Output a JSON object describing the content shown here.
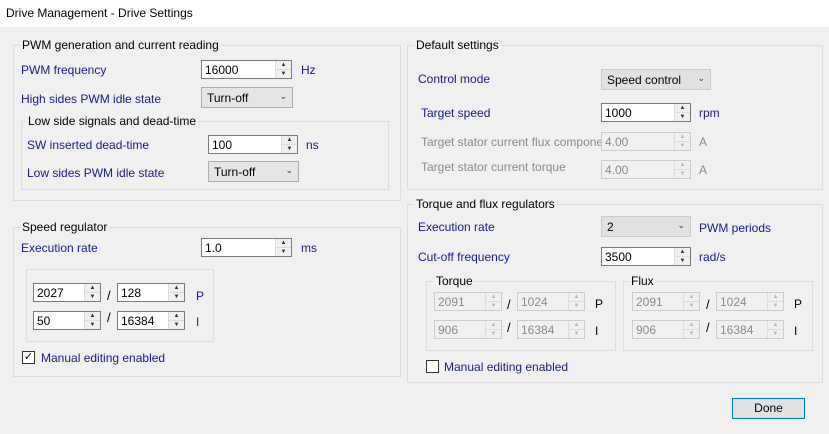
{
  "window": {
    "title": "Drive Management - Drive Settings"
  },
  "pwm": {
    "group_label": "PWM generation and current reading",
    "freq_label": "PWM frequency",
    "freq_value": "16000",
    "freq_unit": "Hz",
    "high_idle_label": "High sides PWM idle state",
    "high_idle_value": "Turn-off",
    "low_group_label": "Low side signals and dead-time",
    "dead_label": "SW inserted dead-time",
    "dead_value": "100",
    "dead_unit": "ns",
    "low_idle_label": "Low sides PWM idle state",
    "low_idle_value": "Turn-off"
  },
  "speed_reg": {
    "group_label": "Speed regulator",
    "rate_label": "Execution rate",
    "rate_value": "1.0",
    "rate_unit": "ms",
    "p_num": "2027",
    "p_den": "128",
    "p_label": "P",
    "i_num": "50",
    "i_den": "16384",
    "i_label": "I",
    "slash": "/",
    "manual_label": "Manual editing enabled",
    "manual_checked": true
  },
  "defaults": {
    "group_label": "Default settings",
    "mode_label": "Control mode",
    "mode_value": "Speed control",
    "speed_label": "Target speed",
    "speed_value": "1000",
    "speed_unit": "rpm",
    "flux_label": "Target stator current flux component",
    "flux_value": "4.00",
    "flux_unit": "A",
    "torque_label": "Target stator current torque",
    "torque_value": "4.00",
    "torque_unit": "A"
  },
  "tf_reg": {
    "group_label": "Torque and flux regulators",
    "rate_label": "Execution rate",
    "rate_value": "2",
    "rate_unit": "PWM periods",
    "cutoff_label": "Cut-off frequency",
    "cutoff_value": "3500",
    "cutoff_unit": "rad/s",
    "torque": {
      "label": "Torque",
      "p_num": "2091",
      "p_den": "1024",
      "i_num": "906",
      "i_den": "16384"
    },
    "flux": {
      "label": "Flux",
      "p_num": "2091",
      "p_den": "1024",
      "i_num": "906",
      "i_den": "16384"
    },
    "p_label": "P",
    "i_label": "I",
    "slash": "/",
    "manual_label": "Manual editing enabled",
    "manual_checked": false
  },
  "footer": {
    "done_label": "Done"
  }
}
